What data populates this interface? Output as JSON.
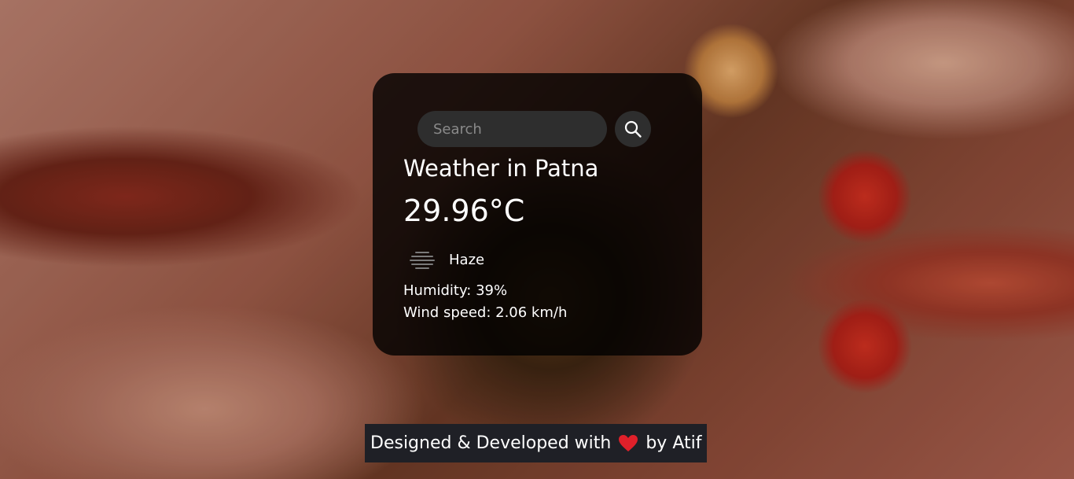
{
  "search": {
    "placeholder": "Search",
    "value": ""
  },
  "weather": {
    "title": "Weather in Patna",
    "temperature": "29.96°C",
    "condition": "Haze",
    "condition_icon": "haze-icon",
    "humidity": "Humidity: 39%",
    "wind": "Wind speed: 2.06 km/h"
  },
  "footer": {
    "prefix": "Designed & Developed with",
    "heart_icon": "heart-icon",
    "suffix": "by Atif",
    "heart_color": "#e0202a"
  },
  "colors": {
    "card_background": "#000000",
    "text": "#ffffff",
    "footer_background": "#1f2026"
  }
}
